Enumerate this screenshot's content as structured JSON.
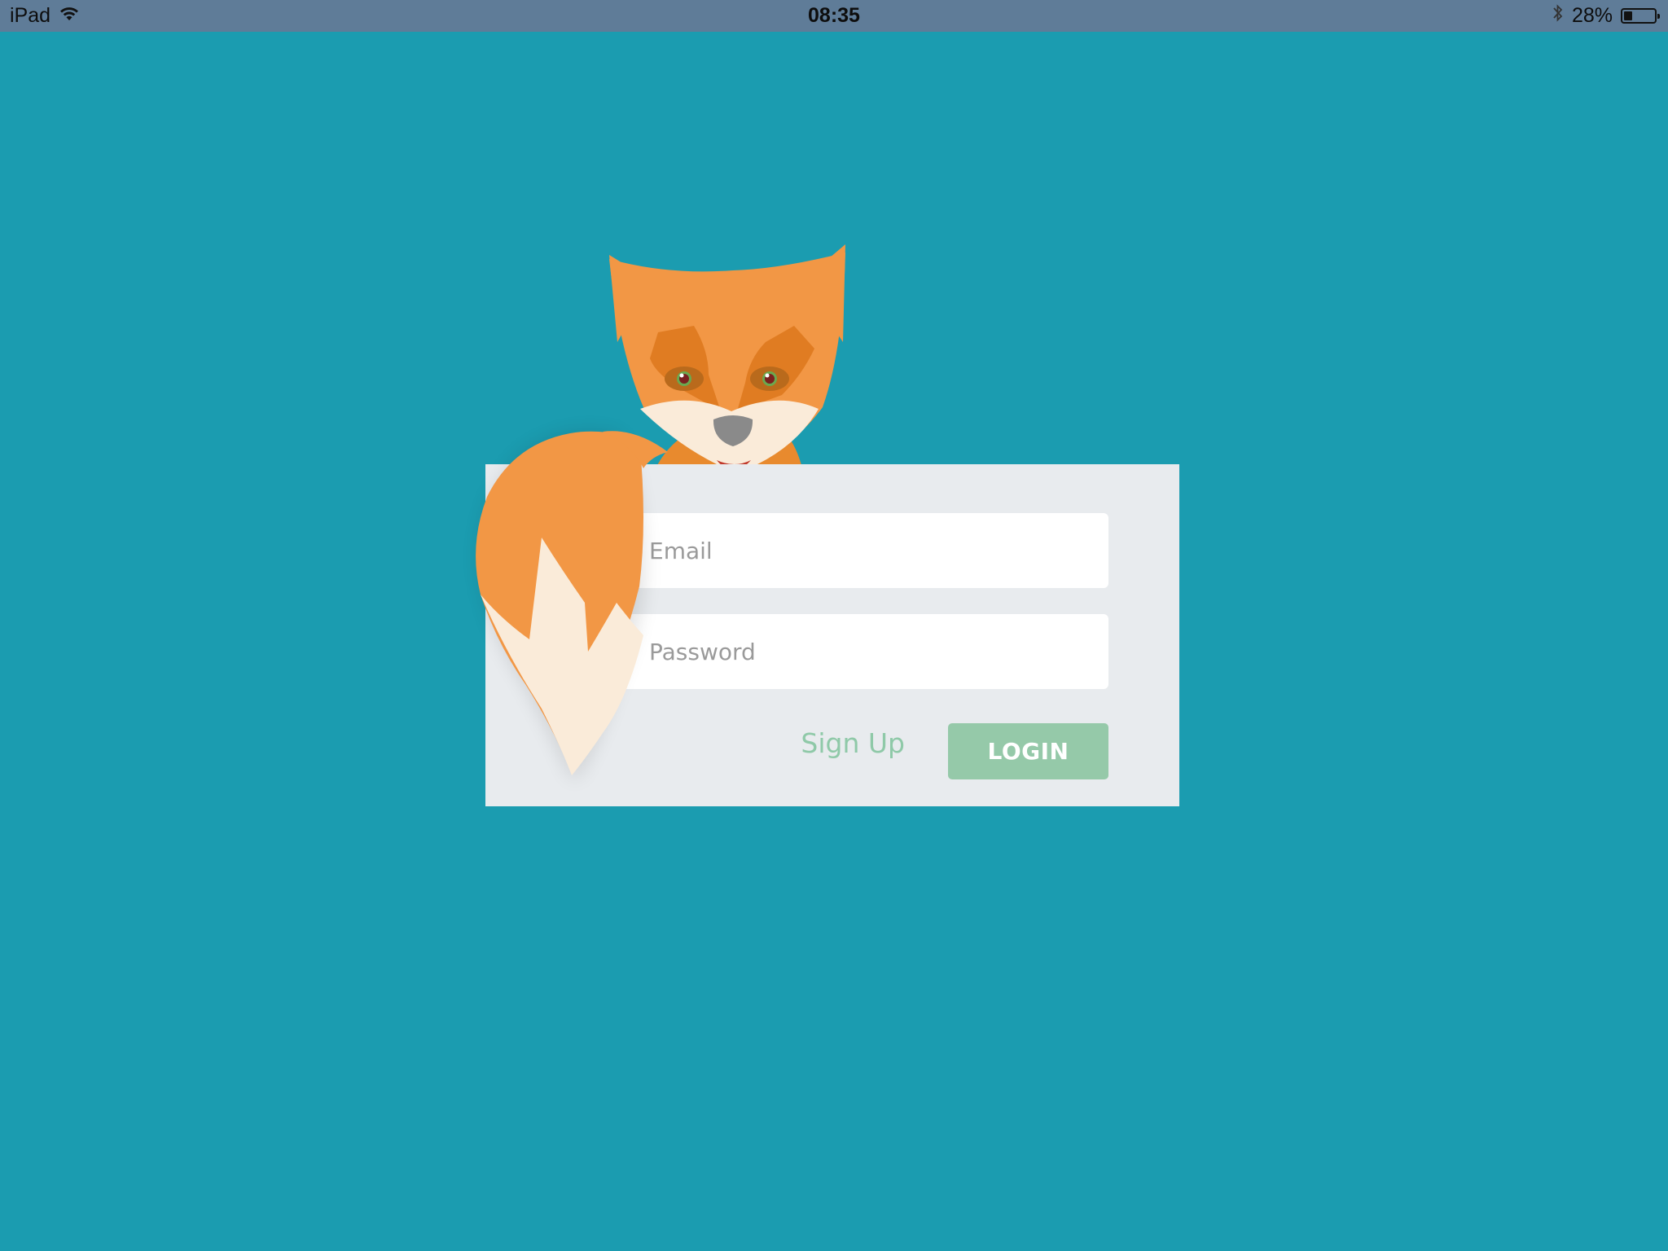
{
  "status_bar": {
    "device": "iPad",
    "time": "08:35",
    "battery_percent": "28%",
    "battery_level": 0.28,
    "icons": [
      "wifi-icon",
      "bluetooth-icon",
      "battery-icon"
    ]
  },
  "login_form": {
    "email_placeholder": "Email",
    "password_placeholder": "Password",
    "signup_label": "Sign Up",
    "login_label": "LOGIN"
  },
  "colors": {
    "background": "#1b9cb0",
    "status_bar": "#5f7c98",
    "card": "#e8ebee",
    "accent_green": "#95c9a9",
    "fox_orange": "#f29745",
    "fox_cream": "#faebd9"
  }
}
